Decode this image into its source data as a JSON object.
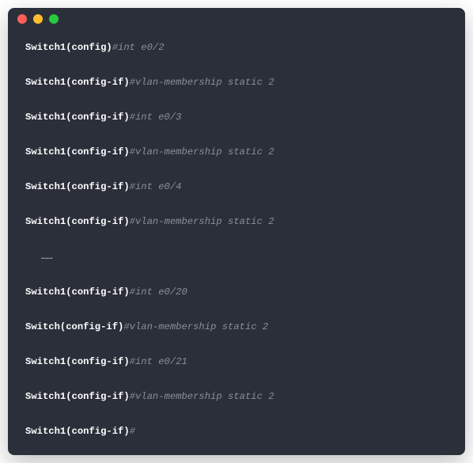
{
  "lines": [
    {
      "prompt": "Switch1(config)",
      "hash": "#",
      "command": "int e0/2"
    },
    {
      "prompt": "Switch1(config-if)",
      "hash": "#",
      "command": "vlan-membership static 2"
    },
    {
      "prompt": "Switch1(config-if)",
      "hash": "#",
      "command": "int e0/3"
    },
    {
      "prompt": "Switch1(config-if)",
      "hash": "#",
      "command": "vlan-membership static 2"
    },
    {
      "prompt": "Switch1(config-if)",
      "hash": "#",
      "command": "int e0/4"
    },
    {
      "prompt": "Switch1(config-if)",
      "hash": "#",
      "command": "vlan-membership static 2"
    },
    {
      "ellipsis": "……"
    },
    {
      "prompt": "Switch1(config-if)",
      "hash": "#",
      "command": "int e0/20"
    },
    {
      "prompt": "Switch(config-if)",
      "hash": "#",
      "command": "vlan-membership static 2"
    },
    {
      "prompt": "Switch1(config-if)",
      "hash": "#",
      "command": "int e0/21"
    },
    {
      "prompt": "Switch1(config-if)",
      "hash": "#",
      "command": "vlan-membership static 2"
    },
    {
      "prompt": "Switch1(config-if)",
      "hash": "#",
      "command": ""
    }
  ]
}
